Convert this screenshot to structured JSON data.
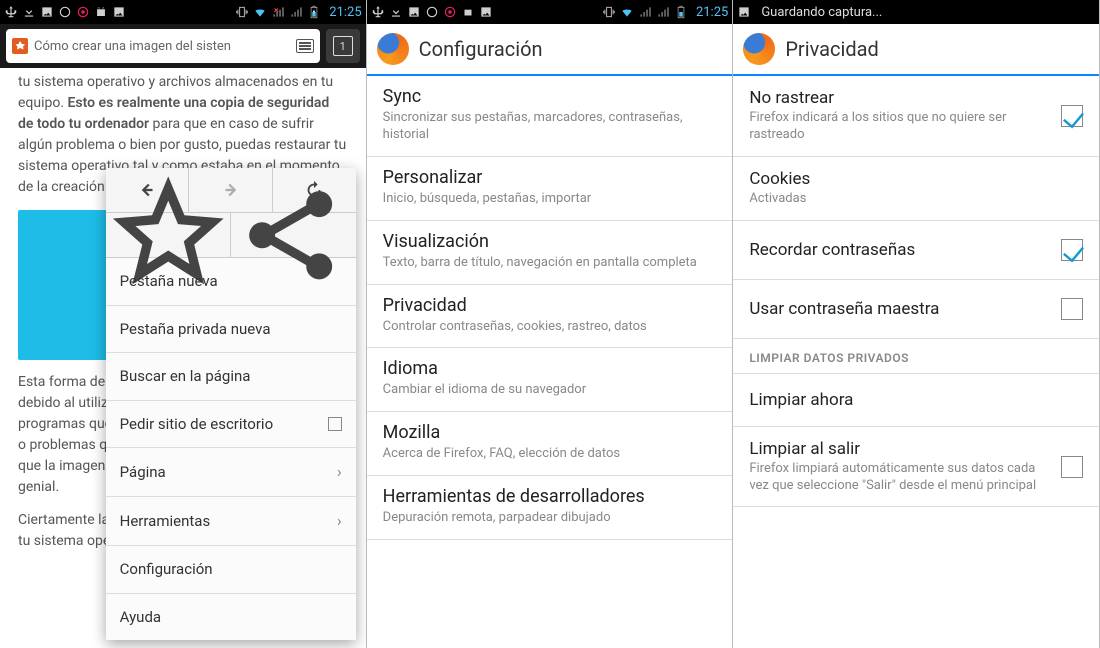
{
  "statusbar": {
    "time": "21:25",
    "saving_text": "Guardando captura..."
  },
  "screen1": {
    "urlbar_text": "Cómo crear una imagen del sisten",
    "tab_count": "1",
    "body_html_lead": "tu sistema operativo y archivos almacenados en tu equipo. Esto es realmente una copia de seguridad de todo tu ordenador para que en caso de sufrir algún problema o bien por gusto, puedas restaurar tu sistema operativo tal y como estaba en el momento de la creación de la misma.",
    "body_partial2": "Esta forma de seguridad es necesaria para tu equipo debido al utilizarla no solo estas guardando los programas que tienes instalados sino que los errores o problemas que pudieras restablecer en el caso de que la imagen del sistema: Windows 10 es así de genial.",
    "body_partial3": "Ciertamente la única forma de copia d seguridad de tu sistema operativo con.",
    "menu": {
      "new_tab": "Pestaña nueva",
      "new_private": "Pestaña privada nueva",
      "find": "Buscar en la página",
      "desktop": "Pedir sitio de escritorio",
      "page": "Página",
      "tools": "Herramientas",
      "settings": "Configuración",
      "help": "Ayuda"
    }
  },
  "screen2": {
    "title": "Configuración",
    "items": [
      {
        "title": "Sync",
        "sub": "Sincronizar sus pestañas, marcadores, contraseñas, historial"
      },
      {
        "title": "Personalizar",
        "sub": "Inicio, búsqueda, pestañas, importar"
      },
      {
        "title": "Visualización",
        "sub": "Texto, barra de título, navegación en pantalla completa"
      },
      {
        "title": "Privacidad",
        "sub": "Controlar contraseñas, cookies, rastreo, datos"
      },
      {
        "title": "Idioma",
        "sub": "Cambiar el idioma de su navegador"
      },
      {
        "title": "Mozilla",
        "sub": "Acerca de Firefox, FAQ, elección de datos"
      },
      {
        "title": "Herramientas de desarrolladores",
        "sub": "Depuración remota, parpadear dibujado"
      }
    ]
  },
  "screen3": {
    "title": "Privacidad",
    "dnt_title": "No rastrear",
    "dnt_sub": "Firefox indicará a los sitios que no quiere ser rastreado",
    "cookies_title": "Cookies",
    "cookies_sub": "Activadas",
    "remember_pw": "Recordar contraseñas",
    "master_pw": "Usar contraseña maestra",
    "section": "LIMPIAR DATOS PRIVADOS",
    "clear_now": "Limpiar ahora",
    "clear_exit_title": "Limpiar al salir",
    "clear_exit_sub": "Firefox limpiará automáticamente sus datos cada vez que seleccione \"Salir\" desde el menú principal"
  }
}
